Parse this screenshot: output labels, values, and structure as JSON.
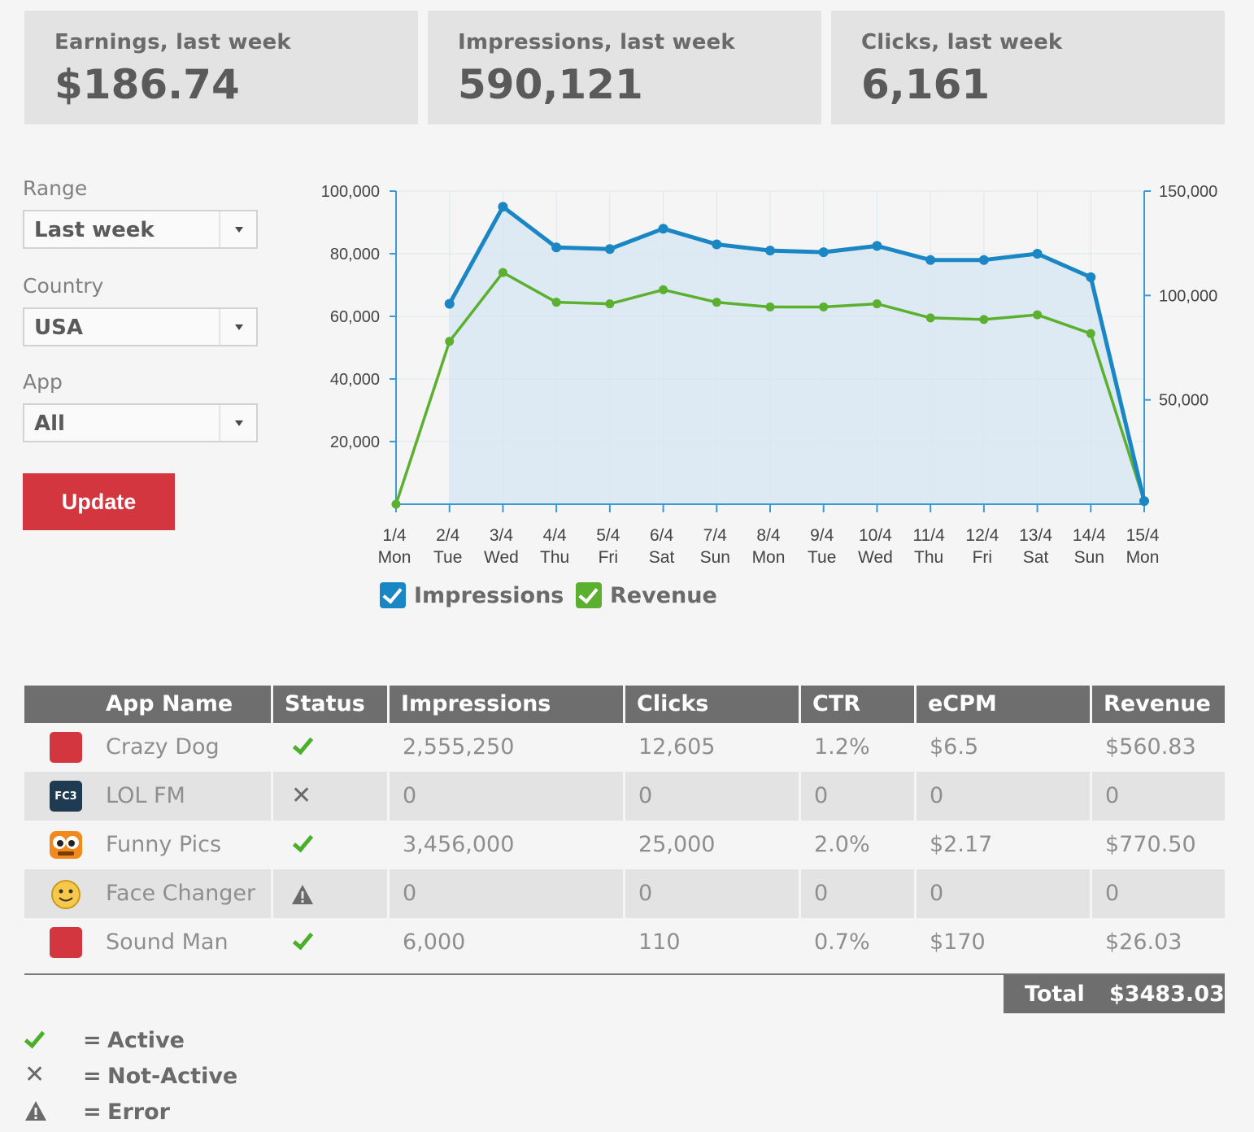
{
  "stats": [
    {
      "label": "Earnings, last week",
      "value": "$186.74"
    },
    {
      "label": "Impressions, last week",
      "value": "590,121"
    },
    {
      "label": "Clicks, last week",
      "value": "6,161"
    }
  ],
  "filters": {
    "range_label": "Range",
    "range_value": "Last week",
    "country_label": "Country",
    "country_value": "USA",
    "app_label": "App",
    "app_value": "All",
    "update_label": "Update"
  },
  "chart_data": {
    "type": "line",
    "x_dates": [
      "1/4",
      "2/4",
      "3/4",
      "4/4",
      "5/4",
      "6/4",
      "7/4",
      "8/4",
      "9/4",
      "10/4",
      "11/4",
      "12/4",
      "13/4",
      "14/4",
      "15/4"
    ],
    "x_days": [
      "Mon",
      "Tue",
      "Wed",
      "Thu",
      "Fri",
      "Sat",
      "Sun",
      "Mon",
      "Tue",
      "Wed",
      "Thu",
      "Fri",
      "Sat",
      "Sun",
      "Mon"
    ],
    "y_left_ticks": [
      "100,000",
      "80,000",
      "60,000",
      "40,000",
      "20,000"
    ],
    "y_right_ticks": [
      "150,000",
      "100,000",
      "50,000"
    ],
    "ylim_left": [
      0,
      100000
    ],
    "ylim_right": [
      0,
      150000
    ],
    "series": [
      {
        "name": "Impressions",
        "color": "#1a86c4",
        "axis": "left",
        "area": true,
        "values": [
          null,
          64000,
          95000,
          82000,
          81500,
          88000,
          83000,
          81000,
          80500,
          82500,
          78000,
          78000,
          80000,
          72500,
          1000
        ]
      },
      {
        "name": "Revenue",
        "color": "#5cb030",
        "axis": "left",
        "values": [
          0,
          52000,
          74000,
          64500,
          64000,
          68500,
          64500,
          63000,
          63000,
          64000,
          59500,
          59000,
          60500,
          54500,
          1000
        ]
      }
    ],
    "legend": [
      "Impressions",
      "Revenue"
    ],
    "grid": true
  },
  "table": {
    "headers": [
      "App Name",
      "Status",
      "Impressions",
      "Clicks",
      "CTR",
      "eCPM",
      "Revenue"
    ],
    "rows": [
      {
        "icon": "red-square-icon",
        "name": "Crazy Dog",
        "status": "active",
        "impressions": "2,555,250",
        "clicks": "12,605",
        "ctr": "1.2%",
        "ecpm": "$6.5",
        "revenue": "$560.83"
      },
      {
        "icon": "fc3-icon",
        "name": "LOL FM",
        "status": "not-active",
        "impressions": "0",
        "clicks": "0",
        "ctr": "0",
        "ecpm": "0",
        "revenue": "0"
      },
      {
        "icon": "funny-face-icon",
        "name": "Funny Pics",
        "status": "active",
        "impressions": "3,456,000",
        "clicks": "25,000",
        "ctr": "2.0%",
        "ecpm": "$2.17",
        "revenue": "$770.50"
      },
      {
        "icon": "smiley-icon",
        "name": "Face Changer",
        "status": "error",
        "impressions": "0",
        "clicks": "0",
        "ctr": "0",
        "ecpm": "0",
        "revenue": "0"
      },
      {
        "icon": "red-square-icon",
        "name": "Sound Man",
        "status": "active",
        "impressions": "6,000",
        "clicks": "110",
        "ctr": "0.7%",
        "ecpm": "$170",
        "revenue": "$26.03"
      }
    ],
    "total_label": "Total",
    "total_value": "$3483.03",
    "icon_text_fc3": "FC3"
  },
  "key": [
    {
      "icon": "check-icon",
      "eq": "=",
      "text": "Active"
    },
    {
      "icon": "x-icon",
      "eq": "=",
      "text": "Not-Active"
    },
    {
      "icon": "warning-icon",
      "eq": "=",
      "text": "Error"
    }
  ],
  "colors": {
    "accent": "#d3363f",
    "impressions": "#1a86c4",
    "revenue": "#5cb030",
    "header": "#6e6e6e"
  }
}
